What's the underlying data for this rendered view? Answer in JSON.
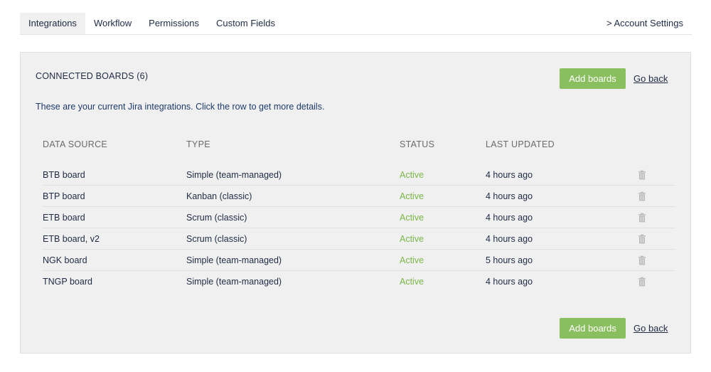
{
  "tabs": [
    {
      "label": "Integrations",
      "active": true
    },
    {
      "label": "Workflow",
      "active": false
    },
    {
      "label": "Permissions",
      "active": false
    },
    {
      "label": "Custom Fields",
      "active": false
    }
  ],
  "account_link": "> Account Settings",
  "panel": {
    "title": "CONNECTED BOARDS (6)",
    "add_boards_label": "Add boards",
    "go_back_label": "Go back",
    "intro": "These are your current Jira integrations. Click the row to get more details."
  },
  "table": {
    "headers": {
      "source": "DATA SOURCE",
      "type": "TYPE",
      "status": "STATUS",
      "updated": "LAST UPDATED"
    },
    "rows": [
      {
        "source": "BTB board",
        "type": "Simple (team-managed)",
        "status": "Active",
        "updated": "4 hours ago"
      },
      {
        "source": "BTP board",
        "type": "Kanban (classic)",
        "status": "Active",
        "updated": "4 hours ago"
      },
      {
        "source": "ETB board",
        "type": "Scrum (classic)",
        "status": "Active",
        "updated": "4 hours ago"
      },
      {
        "source": "ETB board, v2",
        "type": "Scrum (classic)",
        "status": "Active",
        "updated": "4 hours ago"
      },
      {
        "source": "NGK board",
        "type": "Simple (team-managed)",
        "status": "Active",
        "updated": "5 hours ago"
      },
      {
        "source": "TNGP board",
        "type": "Simple (team-managed)",
        "status": "Active",
        "updated": "4 hours ago"
      }
    ],
    "delete_icon": "trash-icon"
  },
  "colors": {
    "accent_button": "#8abf5f",
    "status_active": "#7ab648",
    "panel_background": "#f0f0f0"
  }
}
